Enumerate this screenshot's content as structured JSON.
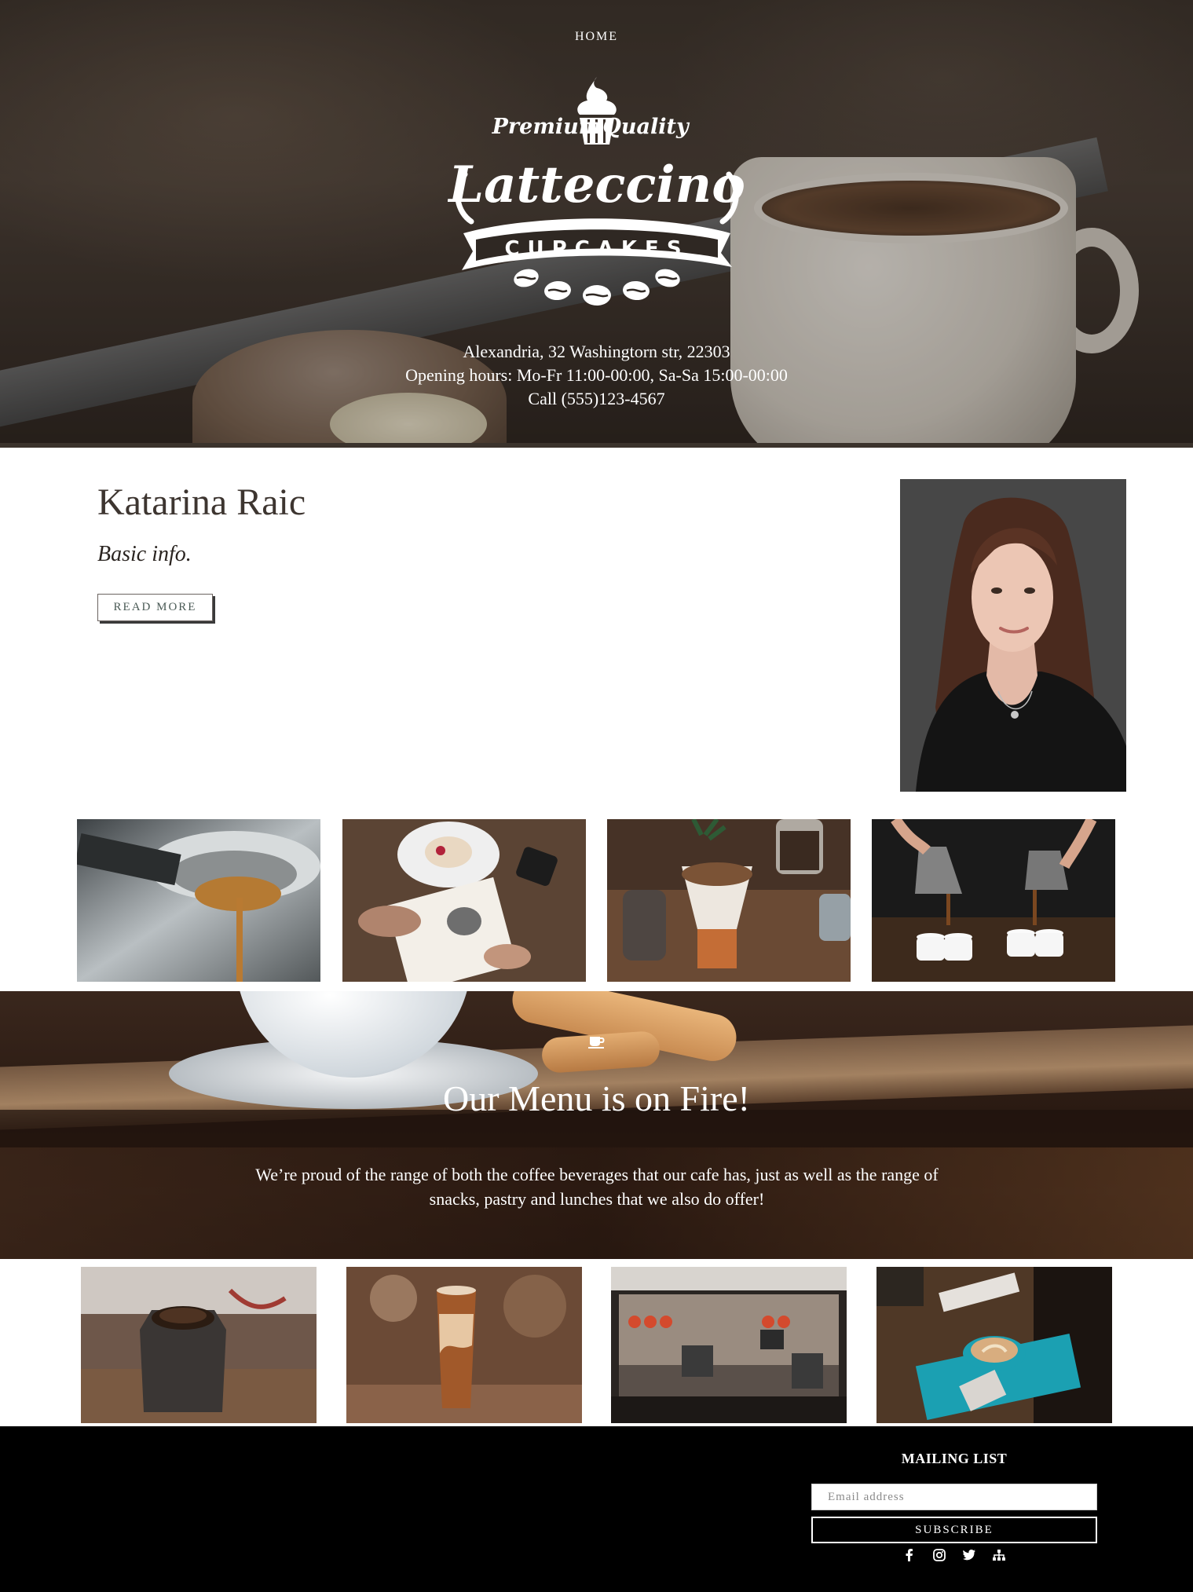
{
  "nav": {
    "home": "HOME"
  },
  "logo": {
    "tagline_left": "Premium",
    "tagline_right": "Quality",
    "name": "Latteccino",
    "ribbon": "CUPCAKES"
  },
  "hero": {
    "address": "Alexandria, 32 Washingtorn str, 22303",
    "hours": "Opening hours: Mo-Fr 11:00-00:00, Sa-Sa 15:00-00:00",
    "phone": "Call (555)123-4567"
  },
  "profile": {
    "name": "Katarina Raic",
    "subtitle": "Basic info.",
    "read_more": "READ MORE"
  },
  "gallery_top": [
    {
      "subject": "espresso-machine-pour"
    },
    {
      "subject": "sketching-with-dessert"
    },
    {
      "subject": "coffee-pourover"
    },
    {
      "subject": "pouring-coffee-cups"
    }
  ],
  "menu": {
    "icon": "coffee-cup-icon",
    "title": "Our Menu is on Fire!",
    "text_line1": "We’re proud of the range of both the coffee beverages that our cafe has, just as well as the range of",
    "text_line2": "snacks, pastry and lunches that we also do offer!"
  },
  "gallery_bottom": [
    {
      "subject": "coffee-grinder"
    },
    {
      "subject": "iced-coffee-glass"
    },
    {
      "subject": "espresso-machine"
    },
    {
      "subject": "latte-art-cup"
    }
  ],
  "footer": {
    "mailing_title": "MAILING LIST",
    "email_placeholder": "Email address",
    "subscribe": "SUBSCRIBE",
    "socials": [
      "facebook-icon",
      "instagram-icon",
      "twitter-icon",
      "sitemap-icon"
    ]
  },
  "colors": {
    "footer_bg": "#000000",
    "text_dark": "#3d3530",
    "button_text": "#4a5a55",
    "hero_overlay": "#2c2520",
    "menu_band": "#2a1a12"
  }
}
